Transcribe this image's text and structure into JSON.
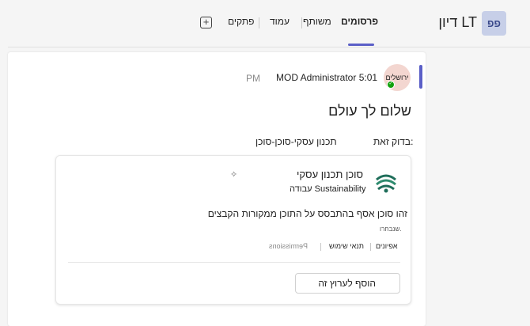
{
  "header": {
    "team_initials": "פפ",
    "team_name": "דיון LT",
    "tabs": [
      {
        "label": "פרסומים",
        "active": true
      },
      {
        "label": "משותף"
      },
      {
        "label": "עמוד"
      },
      {
        "label": "פתקים"
      }
    ],
    "add_tab_symbol": "+"
  },
  "post": {
    "avatar_text": "ירושלים",
    "author": "MOD Administrator 5:01",
    "time": "PM",
    "title": "שלום לך עולם",
    "check_label": "בדוק זאת:",
    "check_value": "תכנון עסקי-סוכן-סוכן"
  },
  "agent_card": {
    "name": "סוכן תכנון עסקי",
    "department": "עבודה Sustainability",
    "description": "זהו סוכן אסף בהתבסס על התוכן ממקורות הקבצים",
    "selected_note": "שנבחרו.",
    "tags": {
      "features": "אפיונים",
      "terms": "תנאי שימוש",
      "permissions": "Permissions"
    },
    "add_button": "הוסף לערוץ זה"
  },
  "colors": {
    "accent": "#5b5fc7",
    "presence": "#13a10e",
    "logo_green": "#1f6e5a"
  }
}
